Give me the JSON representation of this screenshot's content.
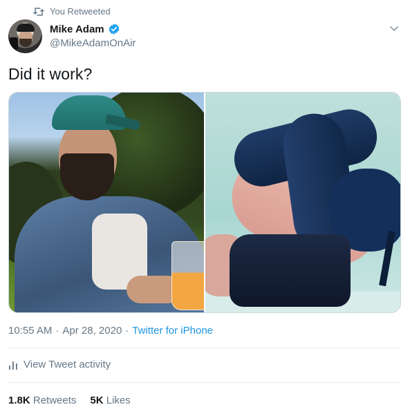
{
  "retweet_context": {
    "label": "You Retweeted",
    "icon": "retweet-icon"
  },
  "author": {
    "display_name": "Mike Adam",
    "handle": "@MikeAdamOnAir",
    "verified": true,
    "avatar_icon": "avatar-photo"
  },
  "menu": {
    "icon": "chevron-down-icon"
  },
  "tweet": {
    "text": "Did it work?"
  },
  "media": [
    {
      "name": "photo-man-in-denim-jacket"
    },
    {
      "name": "photo-legs-in-blue-boots"
    }
  ],
  "meta": {
    "time": "10:55 AM",
    "separator": "·",
    "date": "Apr 28, 2020",
    "source": "Twitter for iPhone"
  },
  "activity": {
    "label": "View Tweet activity",
    "icon": "analytics-icon"
  },
  "stats": {
    "retweets_count": "1.8K",
    "retweets_label": "Retweets",
    "likes_count": "5K",
    "likes_label": "Likes"
  },
  "colors": {
    "text_primary": "#14171a",
    "text_secondary": "#657786",
    "link": "#1b95e0",
    "verified": "#1da1f2",
    "divider": "#e6ecf0"
  }
}
